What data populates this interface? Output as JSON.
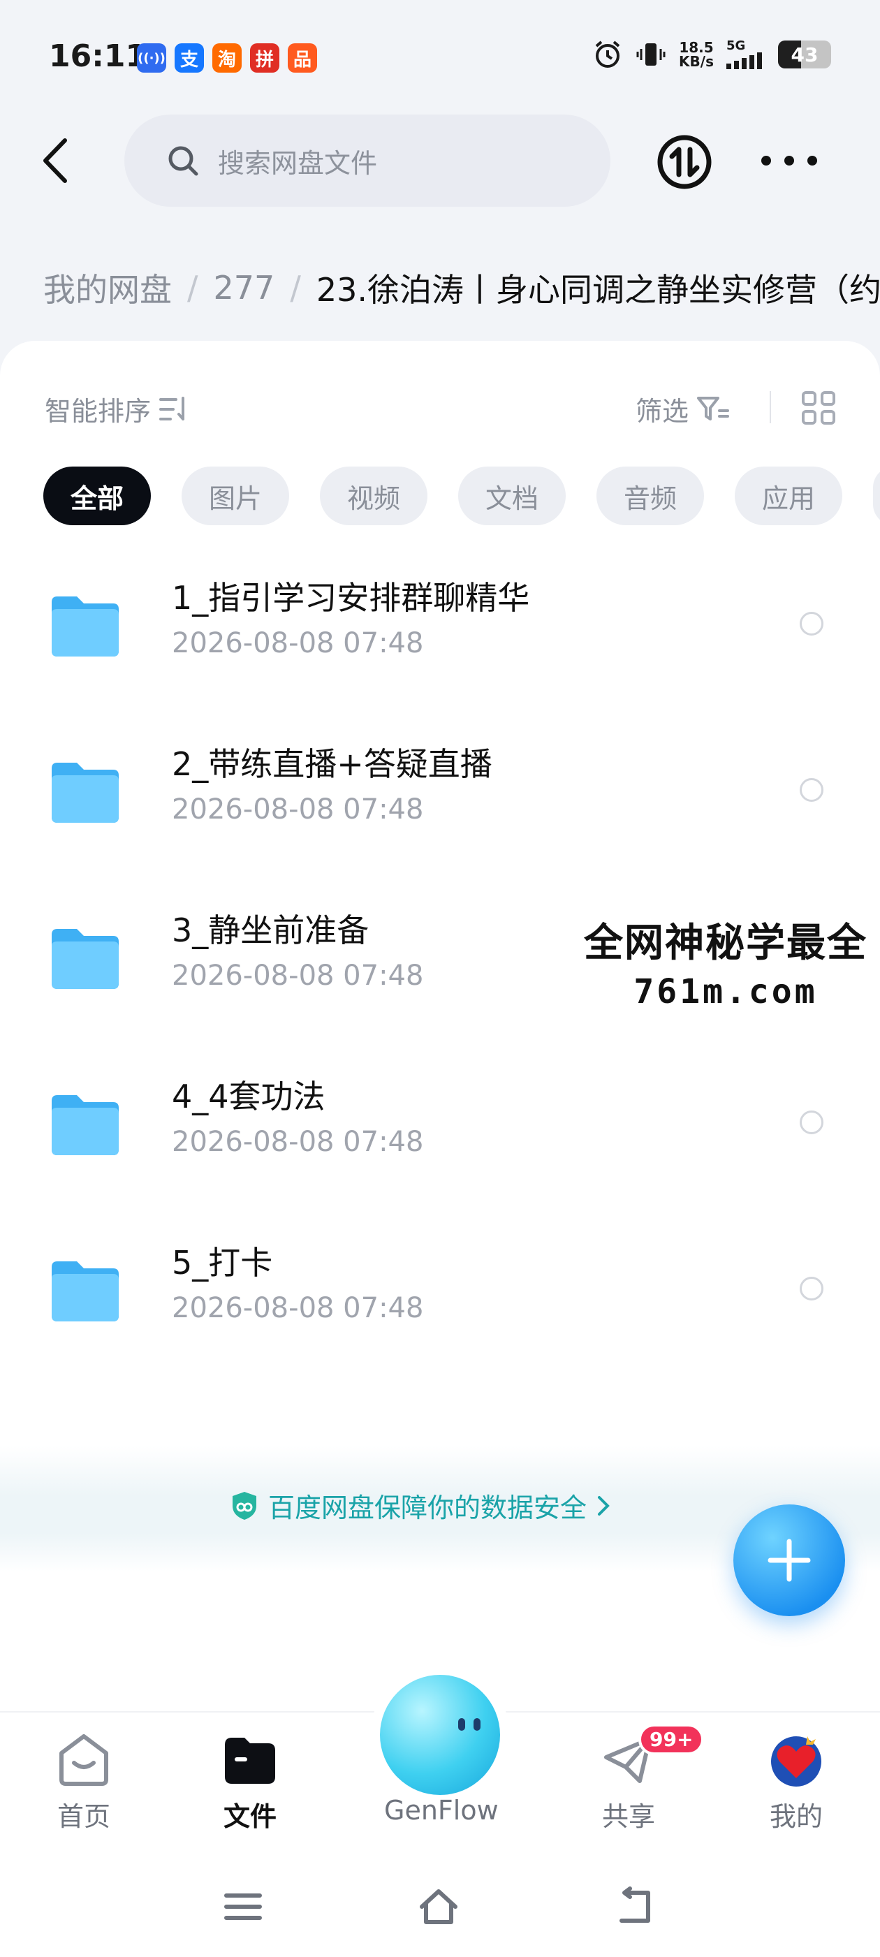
{
  "status_bar": {
    "time": "16:11",
    "apps": [
      {
        "icon": "broadcast-icon",
        "glyph": "((·))",
        "color": "#2f6bf0"
      },
      {
        "icon": "alipay-icon",
        "glyph": "支",
        "color": "#1677ff"
      },
      {
        "icon": "taobao-icon",
        "glyph": "淘",
        "color": "#ff6a00"
      },
      {
        "icon": "pinduoduo-icon",
        "glyph": "拼",
        "color": "#e02e24"
      },
      {
        "icon": "app-icon",
        "glyph": "品",
        "color": "#ff5a1f"
      }
    ],
    "net_speed_value": "18.5",
    "net_speed_unit": "KB/s",
    "network": "5G",
    "battery": "43",
    "battery_level": 0.43
  },
  "header": {
    "search_placeholder": "搜索网盘文件",
    "back_icon": "back-arrow-icon",
    "transfer_icon": "transfer-icon",
    "more_icon": "more-icon"
  },
  "breadcrumb": {
    "items": [
      "我的网盘",
      "277",
      "23.徐泊涛丨身心同调之静坐实修营（约"
    ],
    "separator": "/"
  },
  "toolbar": {
    "sort_label": "智能排序",
    "filter_label": "筛选"
  },
  "chips": [
    "全部",
    "图片",
    "视频",
    "文档",
    "音频",
    "应用"
  ],
  "files": [
    {
      "name": "1_指引学习安排群聊精华",
      "date": "2026-08-08  07:48"
    },
    {
      "name": "2_带练直播+答疑直播",
      "date": "2026-08-08  07:48"
    },
    {
      "name": "3_静坐前准备",
      "date": "2026-08-08  07:48"
    },
    {
      "name": "4_4套功法",
      "date": "2026-08-08  07:48"
    },
    {
      "name": "5_打卡",
      "date": "2026-08-08  07:48"
    }
  ],
  "watermark": {
    "line1": "全网神秘学最全",
    "line2": "761m.com"
  },
  "security_banner": "百度网盘保障你的数据安全",
  "bottom_nav": {
    "home": "首页",
    "files": "文件",
    "genflow": "GenFlow",
    "share": "共享",
    "share_badge": "99+",
    "me": "我的"
  },
  "colors": {
    "accent": "#1a8ff0",
    "folder": "#5cc4ff",
    "security_text": "#1aa3a8",
    "badge": "#f2325a"
  }
}
